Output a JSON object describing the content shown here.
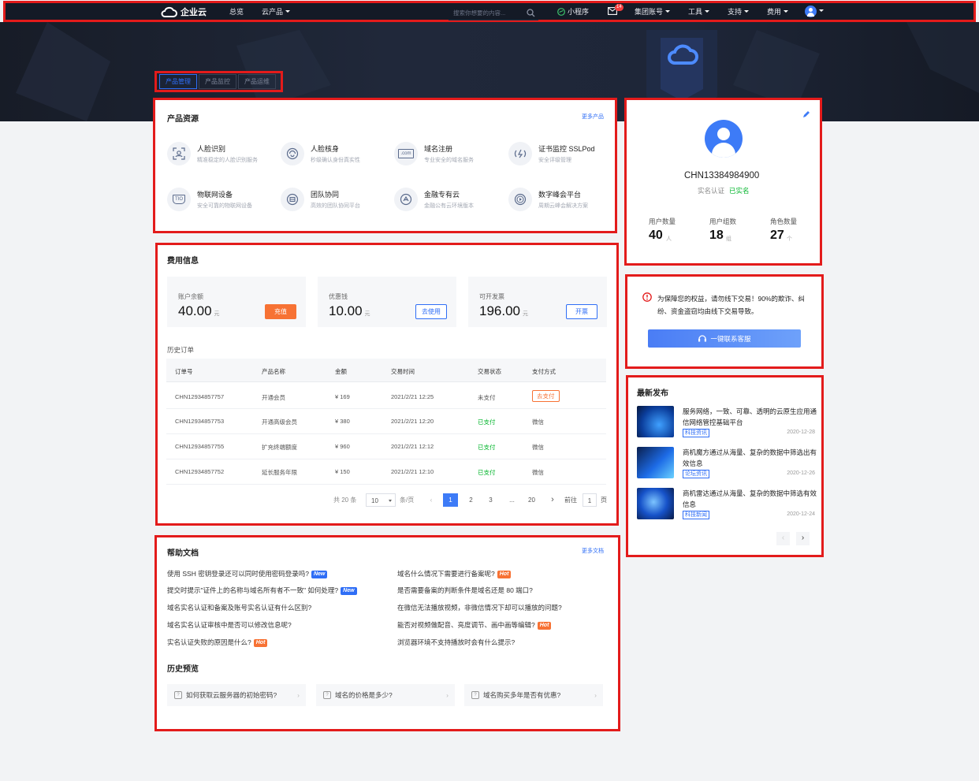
{
  "topbar": {
    "brand": "企业云",
    "nav": [
      "总览",
      "云产品"
    ],
    "search_placeholder": "搜索你想要的内容...",
    "miniprogram": "小程序",
    "mail_badge": "14",
    "menus": [
      "集团账号",
      "工具",
      "支持",
      "费用"
    ]
  },
  "tabs": [
    "产品管理",
    "产品监控",
    "产品运维"
  ],
  "products": {
    "title": "产品资源",
    "more": "更多产品",
    "items": [
      {
        "name": "人脸识别",
        "desc": "精准稳定的人脸识别服务",
        "icon": "face-scan-icon"
      },
      {
        "name": "人脸核身",
        "desc": "秒级确认身份真实性",
        "icon": "face-verify-icon"
      },
      {
        "name": "域名注册",
        "desc": "专业安全的域名服务",
        "icon": "domain-com-icon",
        "icon_text": ".com"
      },
      {
        "name": "证书监控 SSLPod",
        "desc": "安全评级管理",
        "icon": "ssl-monitor-icon"
      },
      {
        "name": "物联网设备",
        "desc": "安全可靠的物联网设备",
        "icon": "iot-shield-icon",
        "icon_text": "TIO"
      },
      {
        "name": "团队协同",
        "desc": "高效的团队协同平台",
        "icon": "team-icon"
      },
      {
        "name": "金融专有云",
        "desc": "金融公有云环境版本",
        "icon": "finance-cloud-icon"
      },
      {
        "name": "数字峰会平台",
        "desc": "周期云峰会解决方案",
        "icon": "play-circle-icon"
      }
    ]
  },
  "fees": {
    "title": "费用信息",
    "balance": {
      "label": "账户余额",
      "value": "40.00",
      "unit": "元",
      "button": "充值"
    },
    "coupon": {
      "label": "优惠钱",
      "value": "10.00",
      "unit": "元",
      "button": "去使用"
    },
    "invoice": {
      "label": "可开发票",
      "value": "196.00",
      "unit": "元",
      "button": "开票"
    }
  },
  "orders": {
    "title": "历史订单",
    "columns": [
      "订单号",
      "产品名称",
      "金额",
      "交易时间",
      "交易状态",
      "支付方式"
    ],
    "rows": [
      {
        "id": "CHN12934857757",
        "product": "开通会员",
        "amount": "¥ 169",
        "time": "2021/2/21 12:25",
        "status": "未支付",
        "pay": "去支付",
        "paid": false
      },
      {
        "id": "CHN12934857753",
        "product": "开通高级会员",
        "amount": "¥ 380",
        "time": "2021/2/21 12:20",
        "status": "已支付",
        "pay": "微信",
        "paid": true
      },
      {
        "id": "CHN12934857755",
        "product": "扩充终端额度",
        "amount": "¥ 960",
        "time": "2021/2/21 12:12",
        "status": "已支付",
        "pay": "微信",
        "paid": true
      },
      {
        "id": "CHN12934857752",
        "product": "延长服务年限",
        "amount": "¥ 150",
        "time": "2021/2/21 12:10",
        "status": "已支付",
        "pay": "微信",
        "paid": true
      }
    ],
    "pagination": {
      "total": "共 20 条",
      "size": "10",
      "per": "条/页",
      "pages": [
        "1",
        "2",
        "3",
        "...",
        "20"
      ],
      "current": "1",
      "goto": "前往",
      "goto_value": "1",
      "page_unit": "页"
    }
  },
  "help": {
    "title": "帮助文档",
    "more": "更多文档",
    "left": [
      {
        "text": "使用 SSH 密钥登录还可以同时使用密码登录吗?",
        "tag": "New"
      },
      {
        "text": "提交时提示\"证件上的名称与域名所有者不一致\" 如何处理?",
        "tag": "New"
      },
      {
        "text": "域名实名认证和备案及账号实名认证有什么区别?",
        "tag": ""
      },
      {
        "text": "域名实名认证审核中是否可以修改信息呢?",
        "tag": ""
      },
      {
        "text": "实名认证失败的原因是什么?",
        "tag": "Hot"
      }
    ],
    "right": [
      {
        "text": "域名什么情况下需要进行备案呢?",
        "tag": "Hot"
      },
      {
        "text": "是否需要备案的判断条件是域名还是 80 端口?",
        "tag": ""
      },
      {
        "text": "在微信无法播放视频，非微信情况下却可以播放的问题?",
        "tag": ""
      },
      {
        "text": "能否对视频做配音、亮度调节、画中画等编辑?",
        "tag": "Hot"
      },
      {
        "text": "浏览器环境不支持播放时会有什么提示?",
        "tag": ""
      }
    ],
    "history_title": "历史预览",
    "history": [
      "如何获取云服务器的初始密码?",
      "域名的价格是多少?",
      "域名购买多年是否有优惠?"
    ]
  },
  "profile": {
    "account": "CHN13384984900",
    "auth_label": "实名认证",
    "auth_status": "已实名",
    "stats": [
      {
        "label": "用户数量",
        "value": "40",
        "unit": "人"
      },
      {
        "label": "用户组数",
        "value": "18",
        "unit": "组"
      },
      {
        "label": "角色数量",
        "value": "27",
        "unit": "个"
      }
    ]
  },
  "notice": {
    "text": "为保障您的权益，请勿线下交易！90%的欺诈、纠纷、资金盗窃均由线下交易导致。",
    "button": "一键联系客服"
  },
  "news": {
    "title": "最新发布",
    "items": [
      {
        "title": "服务网络，一致、可靠、透明的云原生应用通信网络管控基础平台",
        "tag": "科技资讯",
        "date": "2020-12-28"
      },
      {
        "title": "商机魔方通过从海量、复杂的数据中筛选出有效信息",
        "tag": "论坛资讯",
        "date": "2020-12-26"
      },
      {
        "title": "商机雷达通过从海量、复杂的数据中筛选有效信息",
        "tag": "科技新闻",
        "date": "2020-12-24"
      }
    ]
  },
  "colors": {
    "primary": "#2f6ef6",
    "paid": "#00b42a",
    "pay_orange": "#f77234",
    "hot": "#f77234",
    "new": "#2f6ef6",
    "notice_red": "#e31b1b"
  }
}
